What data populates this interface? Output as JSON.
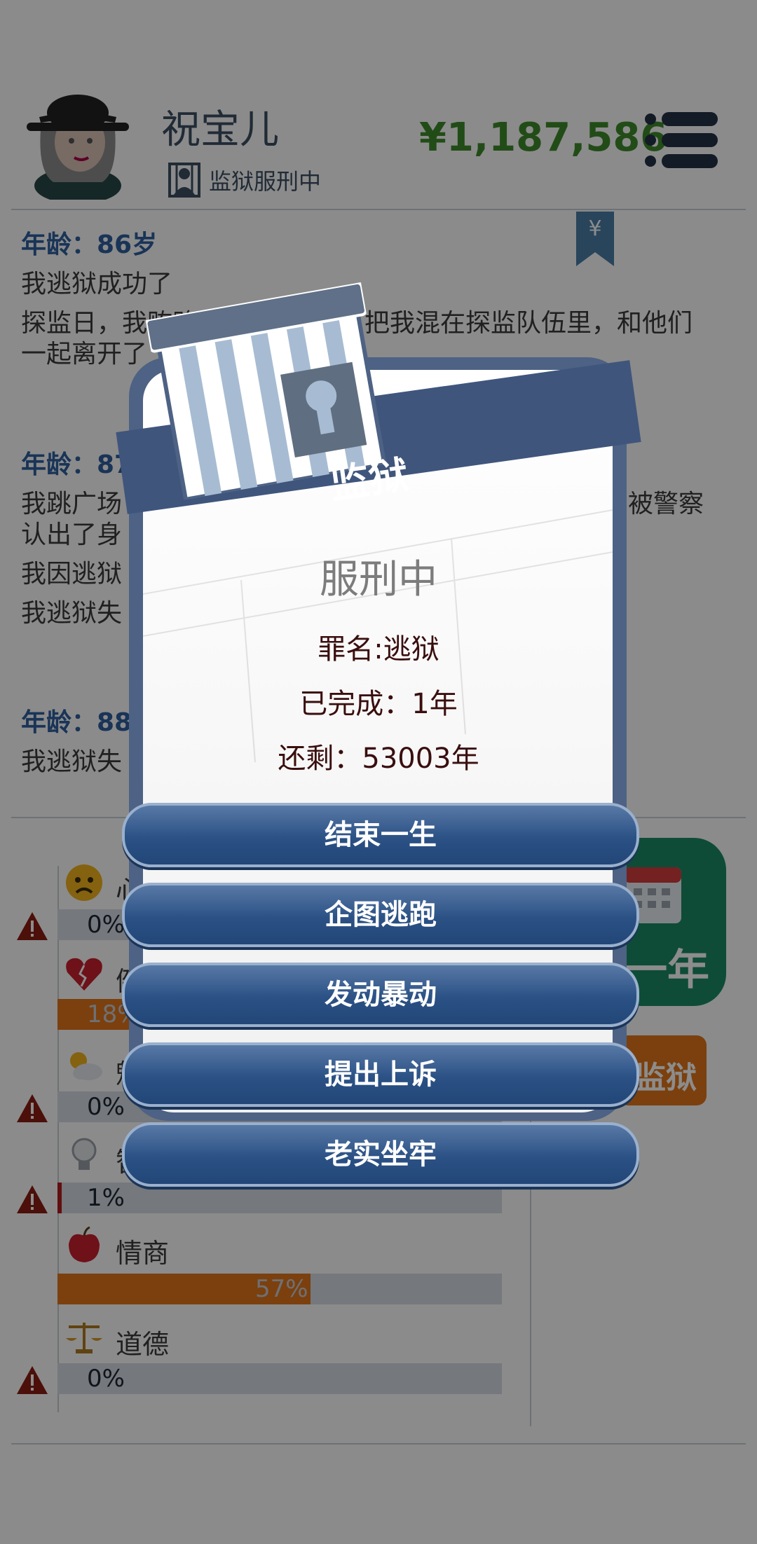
{
  "header": {
    "name": "祝宝儿",
    "status_text": "监狱服刑中",
    "money": "¥1,187,586"
  },
  "log": [
    {
      "age": "年龄：86岁",
      "lines": [
        "我逃狱成功了",
        "探监日，我贿赂了",
        "把我混在探监队伍里，和他们",
        "一起离开了"
      ]
    },
    {
      "age": "年龄：87",
      "lines": [
        "我跳广场",
        "被警察",
        "认出了身",
        "我因逃狱",
        "我逃狱失"
      ]
    },
    {
      "age": "年龄：88",
      "lines": [
        "我逃狱失"
      ]
    }
  ],
  "stats": [
    {
      "label": "心",
      "value": "0%",
      "warn": true,
      "color": "#d5dae2",
      "fraction": 0.0
    },
    {
      "label": "健",
      "value": "18%",
      "warn": false,
      "color": "#e0761a",
      "fraction": 0.18
    },
    {
      "label": "魅",
      "value": "0%",
      "warn": true,
      "color": "#d5dae2",
      "fraction": 0.0
    },
    {
      "label": "智",
      "value": "1%",
      "warn": true,
      "color": "#b21a1a",
      "fraction": 0.01
    },
    {
      "label": "情商",
      "value": "57%",
      "warn": false,
      "color": "#e0761a",
      "fraction": 0.57
    },
    {
      "label": "道德",
      "value": "0%",
      "warn": true,
      "color": "#d5dae2",
      "fraction": 0.0
    }
  ],
  "side": {
    "next_year_label": "一年",
    "prison_label": "监狱"
  },
  "modal": {
    "title": "监狱",
    "status": "服刑中",
    "crime": "罪名:逃狱",
    "completed": "已完成：1年",
    "remaining": "还剩：53003年",
    "buttons": [
      "结束一生",
      "企图逃跑",
      "发动暴动",
      "提出上诉",
      "老实坐牢"
    ]
  },
  "colors": {
    "accent_blue": "#2b5185",
    "money_green": "#3f8a2b",
    "age_blue": "#2f5f9e",
    "orange": "#e0761a",
    "green": "#1b8a67"
  }
}
